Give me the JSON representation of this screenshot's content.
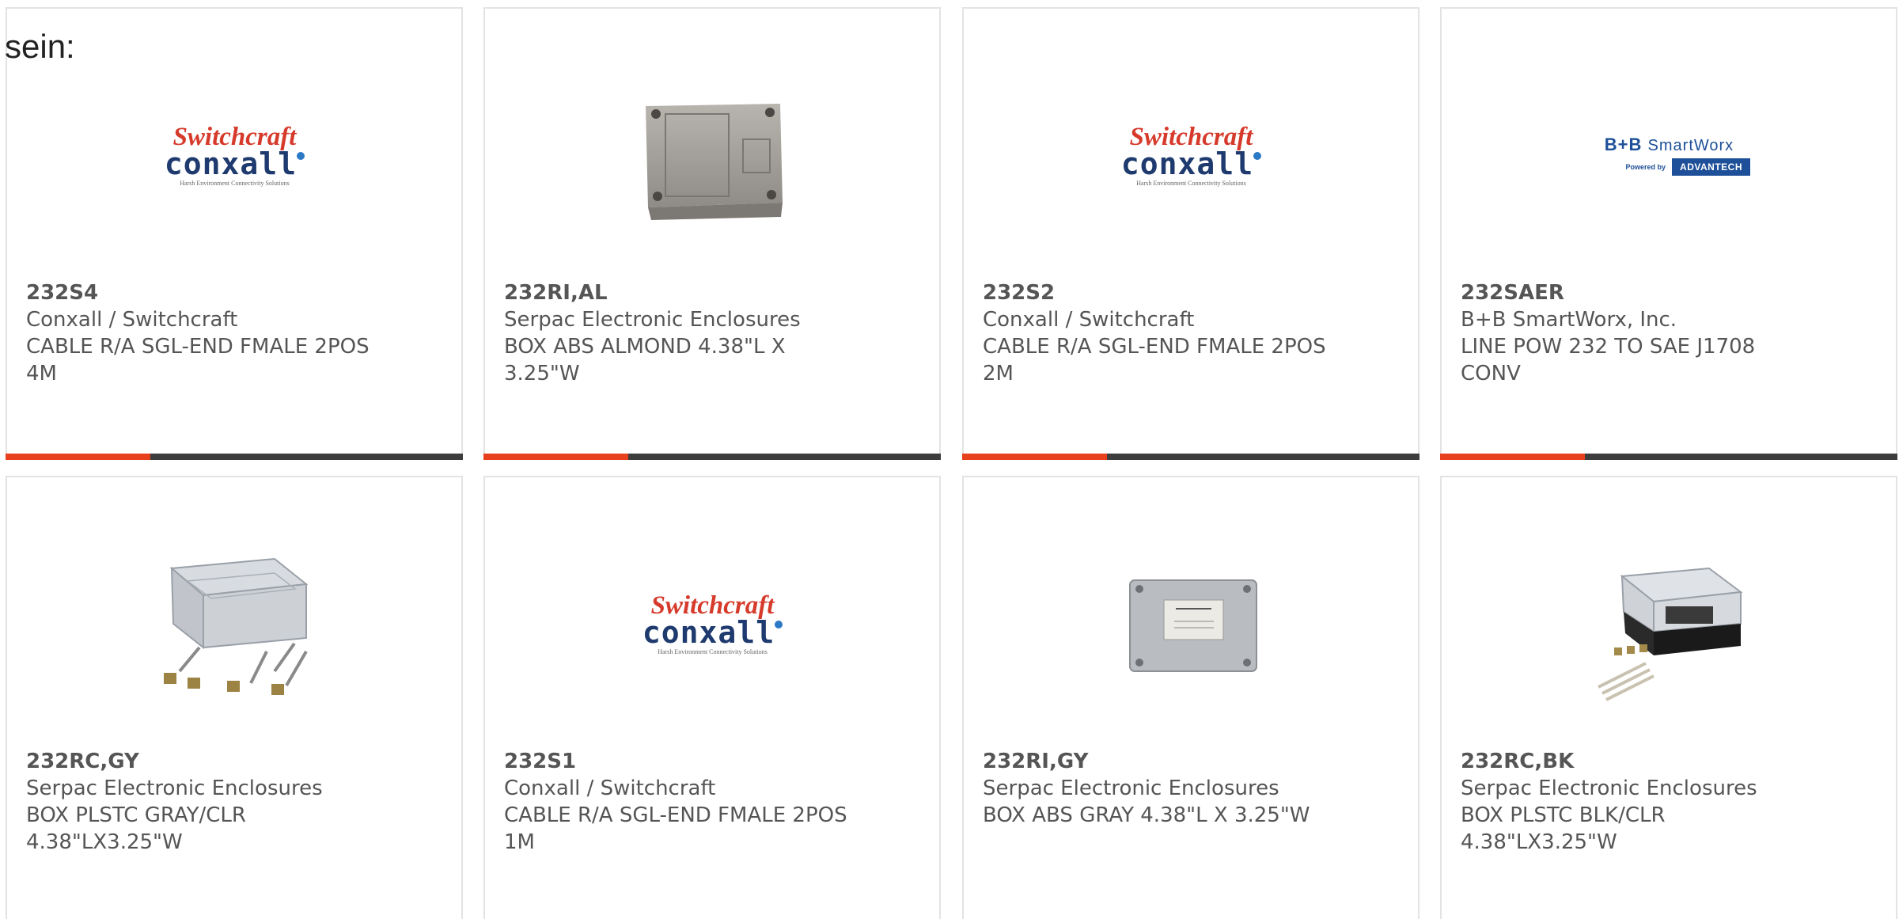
{
  "intro_text": "sein:",
  "accent_color": "#e8401c",
  "bar_color": "#3d3d3d",
  "products": [
    {
      "part": "232S4",
      "manufacturer": "Conxall / Switchcraft",
      "desc_line1": "CABLE R/A SGL-END FMALE 2POS",
      "desc_line2": "4M",
      "image": "switchcraft-conxall-logo"
    },
    {
      "part": "232RI,AL",
      "manufacturer": "Serpac Electronic Enclosures",
      "desc_line1": "BOX ABS ALMOND 4.38\"L X",
      "desc_line2": "3.25\"W",
      "image": "almond-box-photo"
    },
    {
      "part": "232S2",
      "manufacturer": "Conxall / Switchcraft",
      "desc_line1": "CABLE R/A SGL-END FMALE 2POS",
      "desc_line2": "2M",
      "image": "switchcraft-conxall-logo"
    },
    {
      "part": "232SAER",
      "manufacturer": "B+B SmartWorx, Inc.",
      "desc_line1": "LINE POW 232 TO SAE J1708",
      "desc_line2": "CONV",
      "image": "bb-smartworx-logo"
    },
    {
      "part": "232RC,GY",
      "manufacturer": "Serpac Electronic Enclosures",
      "desc_line1": "BOX PLSTC GRAY/CLR",
      "desc_line2": "4.38\"LX3.25\"W",
      "image": "gray-clear-box-photo"
    },
    {
      "part": "232S1",
      "manufacturer": "Conxall / Switchcraft",
      "desc_line1": "CABLE R/A SGL-END FMALE 2POS",
      "desc_line2": "1M",
      "image": "switchcraft-conxall-logo"
    },
    {
      "part": "232RI,GY",
      "manufacturer": "Serpac Electronic Enclosures",
      "desc_line1": "BOX ABS GRAY 4.38\"L X 3.25\"W",
      "desc_line2": "",
      "image": "gray-box-photo"
    },
    {
      "part": "232RC,BK",
      "manufacturer": "Serpac Electronic Enclosures",
      "desc_line1": "BOX PLSTC BLK/CLR",
      "desc_line2": "4.38\"LX3.25\"W",
      "image": "black-clear-box-photo"
    }
  ],
  "logos": {
    "switchcraft": {
      "line1": "Switchcraft",
      "line2": "conxall",
      "line3": "Harsh Environment Connectivity Solutions"
    },
    "bb": {
      "brand_bold": "B+B",
      "brand_rest": "SmartWorx",
      "powered_by": "Powered by",
      "advantech": "ADVANTECH"
    }
  }
}
